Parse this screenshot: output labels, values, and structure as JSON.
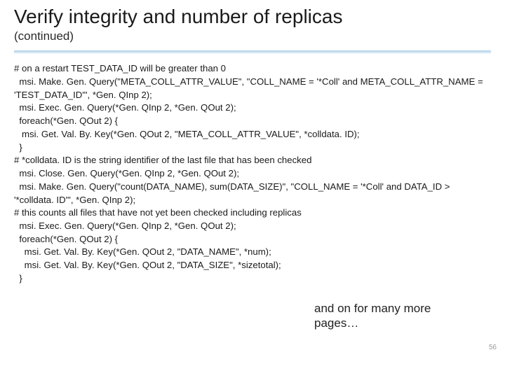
{
  "title": "Verify integrity and number of replicas",
  "subtitle": "(continued)",
  "code": "# on a restart TEST_DATA_ID will be greater than 0\n  msi. Make. Gen. Query(\"META_COLL_ATTR_VALUE\", \"COLL_NAME = '*Coll' and META_COLL_ATTR_NAME = 'TEST_DATA_ID'\", *Gen. QInp 2);\n  msi. Exec. Gen. Query(*Gen. QInp 2, *Gen. QOut 2);\n  foreach(*Gen. QOut 2) {\n   msi. Get. Val. By. Key(*Gen. QOut 2, \"META_COLL_ATTR_VALUE\", *colldata. ID);\n  }\n# *colldata. ID is the string identifier of the last file that has been checked\n  msi. Close. Gen. Query(*Gen. QInp 2, *Gen. QOut 2);\n  msi. Make. Gen. Query(\"count(DATA_NAME), sum(DATA_SIZE)\", \"COLL_NAME = '*Coll' and DATA_ID > '*colldata. ID'\", *Gen. QInp 2);\n# this counts all files that have not yet been checked including replicas\n  msi. Exec. Gen. Query(*Gen. QInp 2, *Gen. QOut 2);\n  foreach(*Gen. QOut 2) {\n    msi. Get. Val. By. Key(*Gen. QOut 2, \"DATA_NAME\", *num);\n    msi. Get. Val. By. Key(*Gen. QOut 2, \"DATA_SIZE\", *sizetotal);\n  }",
  "annotation": "and on for many more pages…",
  "page_number": "56"
}
